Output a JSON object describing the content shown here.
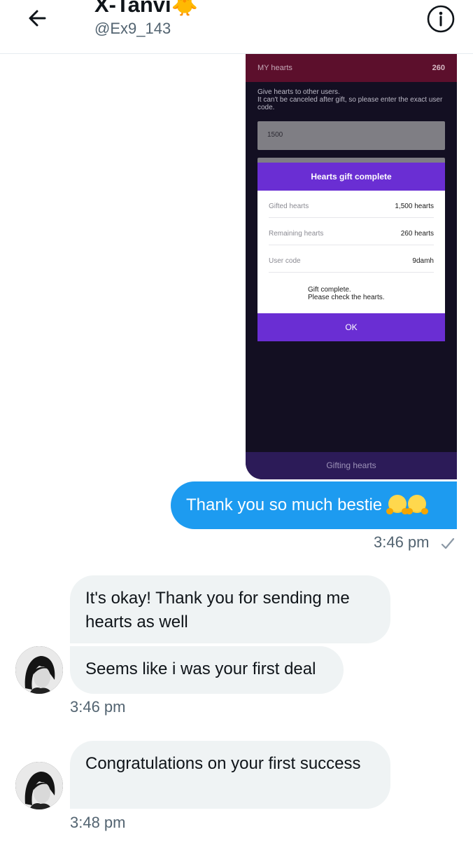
{
  "header": {
    "title": "X-Tanvi🐥",
    "handle": "@Ex9_143"
  },
  "attachment": {
    "my_hearts_label": "MY hearts",
    "my_hearts_value": "260",
    "description": "Give hearts to other users.\n It can't be canceled after gift, so please enter the exact user code.",
    "input_value": "1500",
    "dialog": {
      "title": "Hearts gift complete",
      "rows": [
        {
          "key": "Gifted hearts",
          "value": "1,500 hearts"
        },
        {
          "key": "Remaining hearts",
          "value": "260 hearts"
        },
        {
          "key": "User code",
          "value": "9damh"
        }
      ],
      "message_line1": "Gift complete.",
      "message_line2": "Please check the hearts.",
      "ok_label": "OK"
    },
    "bottom_button": "Gifting hearts"
  },
  "messages": {
    "sent_text": "Thank you so much bestie",
    "sent_time": "3:46 pm",
    "recv1_text": "It's okay! Thank you for sending me hearts as well",
    "recv2_text": "Seems like i was your first deal",
    "recv_time1": "3:46 pm",
    "recv3_text": "Congratulations on your first success",
    "recv_time2": "3:48 pm"
  },
  "colors": {
    "accent_blue": "#1d9bf0",
    "dialog_purple": "#6a2ed3",
    "bubble_gray": "#eff3f4"
  }
}
